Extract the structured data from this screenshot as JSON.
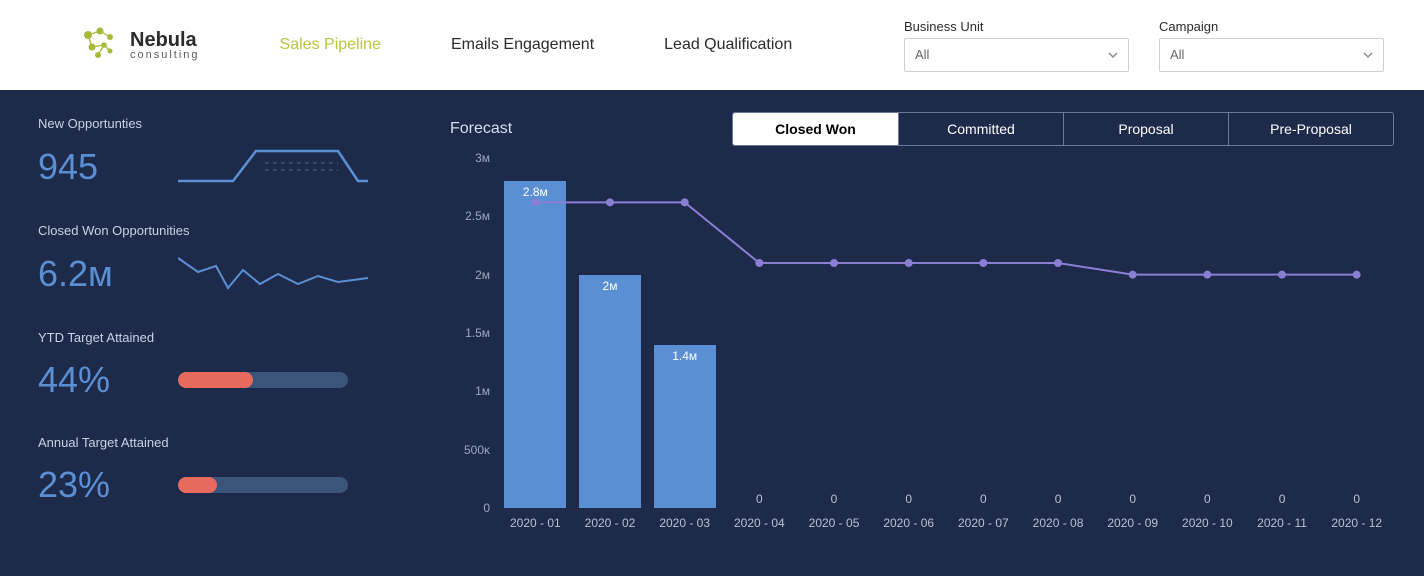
{
  "brand": {
    "name": "Nebula",
    "sub": "consulting"
  },
  "nav": {
    "tabs": [
      {
        "label": "Sales Pipeline",
        "active": true
      },
      {
        "label": "Emails Engagement",
        "active": false
      },
      {
        "label": "Lead Qualification",
        "active": false
      }
    ]
  },
  "filters": {
    "business_unit": {
      "label": "Business Unit",
      "value": "All"
    },
    "campaign": {
      "label": "Campaign",
      "value": "All"
    }
  },
  "kpis": {
    "new_opps": {
      "label": "New Opportunties",
      "value": "945"
    },
    "closed_won": {
      "label": "Closed Won Opportunities",
      "value": "6.2ᴍ"
    },
    "ytd": {
      "label": "YTD Target Attained",
      "value": "44%",
      "pct": 44
    },
    "annual": {
      "label": "Annual Target Attained",
      "value": "23%",
      "pct": 23
    }
  },
  "forecast": {
    "title": "Forecast",
    "tabs": [
      {
        "label": "Closed Won",
        "active": true
      },
      {
        "label": "Committed",
        "active": false
      },
      {
        "label": "Proposal",
        "active": false
      },
      {
        "label": "Pre-Proposal",
        "active": false
      }
    ]
  },
  "chart_data": {
    "type": "bar",
    "title": "Forecast",
    "ylabel": "",
    "xlabel": "",
    "ylim": [
      0,
      3000000
    ],
    "y_ticks": [
      "0",
      "500ᴋ",
      "1ᴍ",
      "1.5ᴍ",
      "2ᴍ",
      "2.5ᴍ",
      "3ᴍ"
    ],
    "categories": [
      "2020 - 01",
      "2020 - 02",
      "2020 - 03",
      "2020 - 04",
      "2020 - 05",
      "2020 - 06",
      "2020 - 07",
      "2020 - 08",
      "2020 - 09",
      "2020 - 10",
      "2020 - 11",
      "2020 - 12"
    ],
    "series": [
      {
        "name": "Closed Won (bars)",
        "type": "bar",
        "values": [
          2800000,
          2000000,
          1400000,
          0,
          0,
          0,
          0,
          0,
          0,
          0,
          0,
          0
        ],
        "display_labels": [
          "2.8ᴍ",
          "2ᴍ",
          "1.4ᴍ",
          "0",
          "0",
          "0",
          "0",
          "0",
          "0",
          "0",
          "0",
          "0"
        ]
      },
      {
        "name": "Forecast (line)",
        "type": "line",
        "values": [
          2620000,
          2620000,
          2620000,
          2100000,
          2100000,
          2100000,
          2100000,
          2100000,
          2000000,
          2000000,
          2000000,
          2000000
        ]
      }
    ]
  }
}
